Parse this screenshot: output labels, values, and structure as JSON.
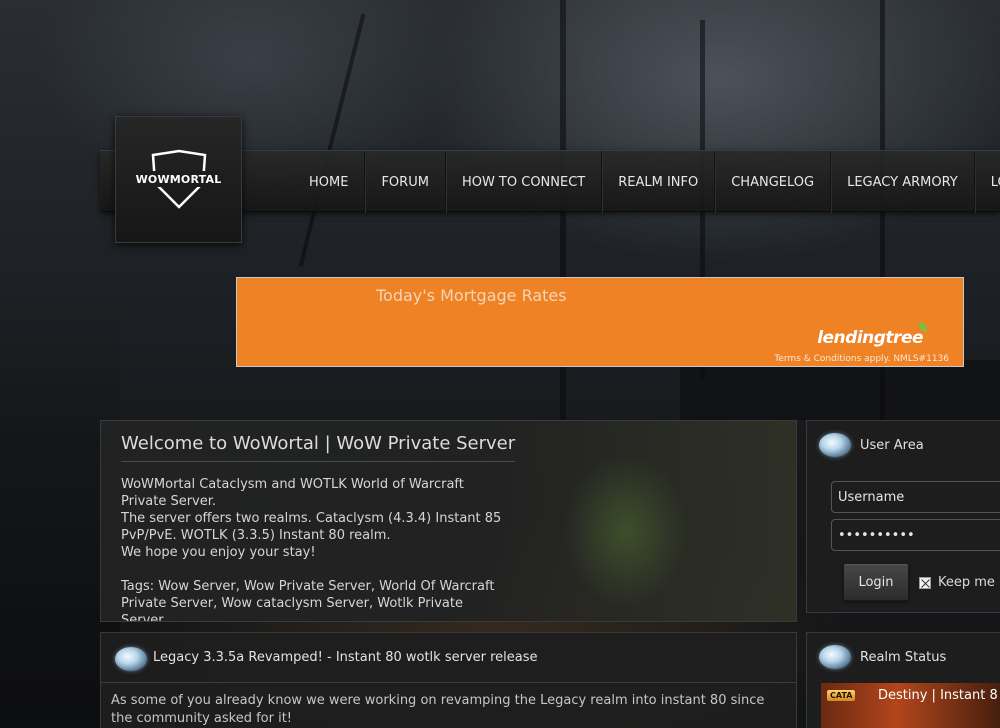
{
  "site": {
    "logo_text": "WOWMORTAL"
  },
  "nav": {
    "items": [
      {
        "label": "HOME"
      },
      {
        "label": "FORUM"
      },
      {
        "label": "HOW TO CONNECT"
      },
      {
        "label": "REALM INFO"
      },
      {
        "label": "CHANGELOG"
      },
      {
        "label": "LEGACY ARMORY"
      },
      {
        "label": "LOGIN"
      }
    ]
  },
  "ad": {
    "headline": "Today's Mortgage Rates",
    "brand": "lendingtree",
    "terms": "Terms & Conditions apply. NMLS#1136",
    "background_color": "#ee8225"
  },
  "welcome": {
    "title": "Welcome to WoWortal | WoW Private Server",
    "line1": "WoWMortal Cataclysm and WOTLK World of Warcraft",
    "line2": "Private Server.",
    "line3": "The server offers two realms. Cataclysm (4.3.4) Instant 85",
    "line4": "PvP/PvE. WOTLK (3.3.5) Instant 80 realm.",
    "line5": "We hope you enjoy your stay!",
    "tags1": "Tags: Wow Server, Wow Private Server, World Of Warcraft",
    "tags2": "Private Server, Wow cataclysm Server, Wotlk Private",
    "tags3": "Server."
  },
  "user_area": {
    "title": "User Area",
    "username_value": "Username",
    "password_value": "••••••••••",
    "login_label": "Login",
    "remember_label": "Keep me"
  },
  "realm_status": {
    "title": "Realm Status",
    "badge": "CATA",
    "realm_name": "Destiny | Instant 8"
  },
  "news": {
    "title": "Legacy 3.3.5a Revamped! - Instant 80 wotlk server release",
    "body_line1": "As some of you already know we were working on revamping the Legacy realm into instant 80 since",
    "body_line2": "the community asked for it!"
  }
}
